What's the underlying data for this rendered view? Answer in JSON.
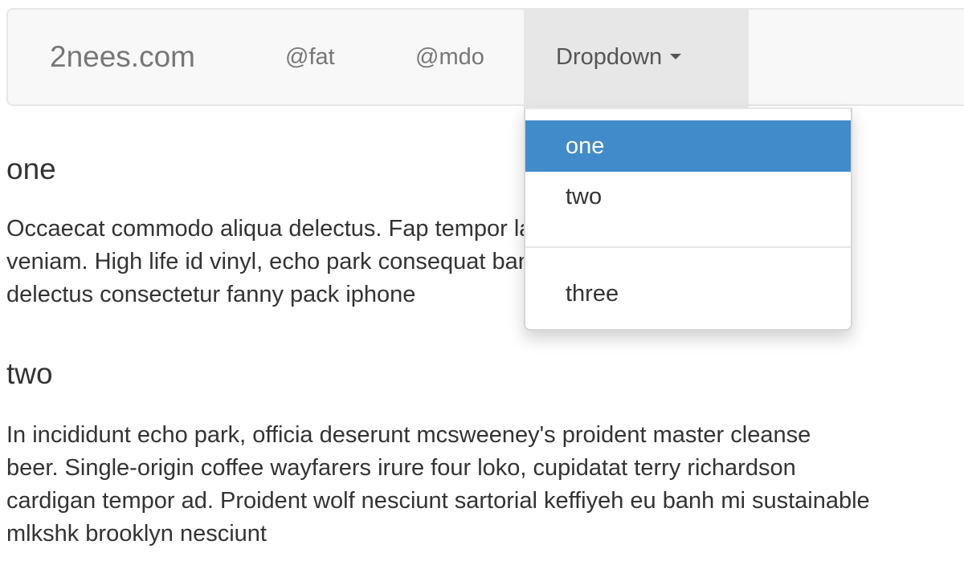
{
  "navbar": {
    "brand": "2nees.com",
    "links": [
      "@fat",
      "@mdo"
    ],
    "dropdown_label": "Dropdown"
  },
  "dropdown": {
    "items": [
      "one",
      "two",
      "three"
    ],
    "selected": "one"
  },
  "sections": [
    {
      "heading": "one",
      "lines": [
        "Occaecat commodo aliqua delectus. Fap tempor laborum skateboard chillwave",
        "veniam. High life id vinyl, echo park consequat banh mi pitchfork",
        "delectus consectetur fanny pack iphone"
      ]
    },
    {
      "heading": "two",
      "lines": [
        "In incididunt echo park, officia deserunt mcsweeney's proident master cleanse",
        "beer. Single-origin coffee wayfarers irure four loko, cupidatat terry richardson",
        "cardigan tempor ad. Proident wolf nesciunt sartorial keffiyeh eu banh mi sustainable",
        "mlkshk brooklyn nesciunt"
      ]
    }
  ],
  "colors": {
    "active_item": "#428bca",
    "navbar_bg": "#f8f8f8",
    "dropdown_toggle_bg": "#e7e7e7"
  }
}
